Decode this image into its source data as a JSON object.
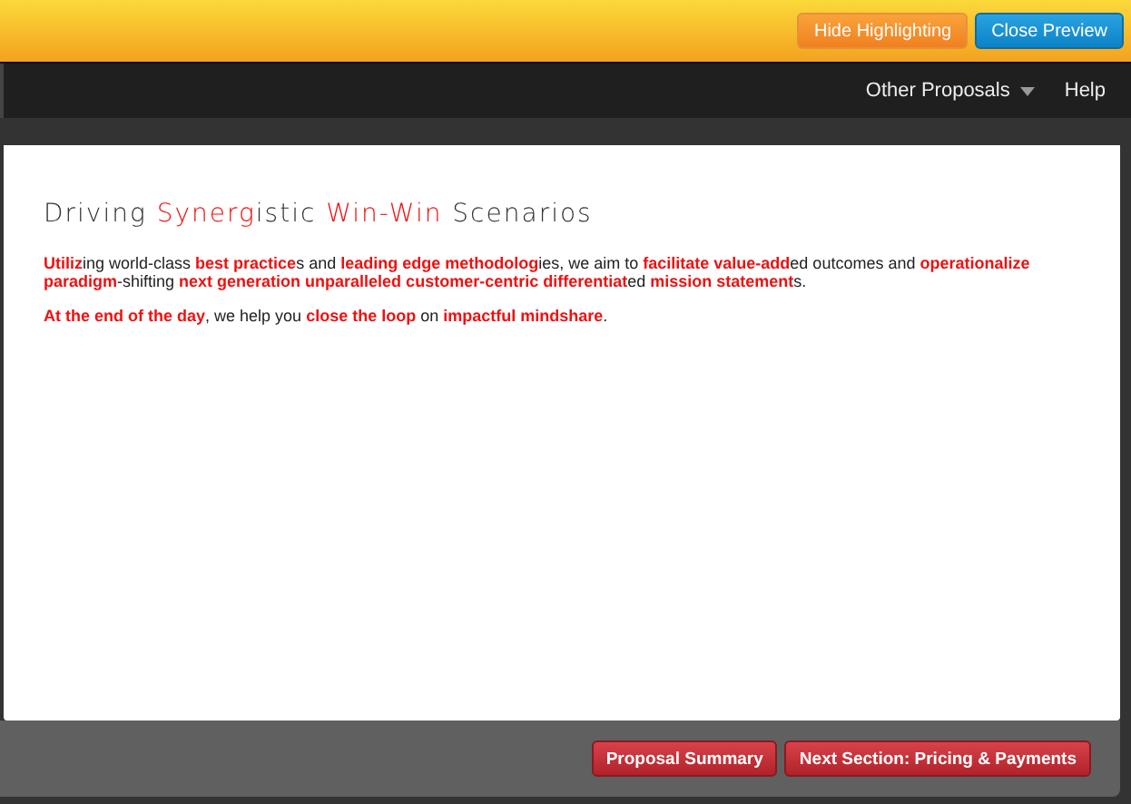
{
  "top_bar": {
    "buttons": [
      {
        "label": "Hide Highlighting",
        "kind": "orange"
      },
      {
        "label": "Close Preview",
        "kind": "blue"
      }
    ]
  },
  "nav": {
    "items": [
      {
        "label": "Other Proposals",
        "dropdown": true
      },
      {
        "label": "Help",
        "dropdown": false
      }
    ]
  },
  "document": {
    "title": [
      {
        "text": "Driving ",
        "highlighted": false
      },
      {
        "text": "Synerg",
        "highlighted": true
      },
      {
        "text": "istic ",
        "highlighted": false
      },
      {
        "text": "Win-Win",
        "highlighted": true
      },
      {
        "text": " Scenarios",
        "highlighted": false
      }
    ],
    "paragraphs": [
      [
        {
          "text": "Utiliz",
          "highlighted": true
        },
        {
          "text": "ing world-class ",
          "highlighted": false
        },
        {
          "text": "best practice",
          "highlighted": true
        },
        {
          "text": "s and ",
          "highlighted": false
        },
        {
          "text": "leading edge methodolog",
          "highlighted": true
        },
        {
          "text": "ies, we aim to ",
          "highlighted": false
        },
        {
          "text": "facilitate value-add",
          "highlighted": true
        },
        {
          "text": "ed outcomes and ",
          "highlighted": false
        },
        {
          "text": "operationalize paradigm",
          "highlighted": true
        },
        {
          "text": "-shifting ",
          "highlighted": false
        },
        {
          "text": "next generation unparalleled customer-centric differentiat",
          "highlighted": true
        },
        {
          "text": "ed ",
          "highlighted": false
        },
        {
          "text": "mission statement",
          "highlighted": true
        },
        {
          "text": "s.",
          "highlighted": false
        }
      ],
      [
        {
          "text": "At the end of the day",
          "highlighted": true
        },
        {
          "text": ", we help you ",
          "highlighted": false
        },
        {
          "text": "close the loop",
          "highlighted": true
        },
        {
          "text": " on ",
          "highlighted": false
        },
        {
          "text": "impactful mindshare",
          "highlighted": true
        },
        {
          "text": ".",
          "highlighted": false
        }
      ]
    ]
  },
  "footer": {
    "buttons": [
      "Proposal Summary",
      "Next Section: Pricing & Payments"
    ]
  }
}
